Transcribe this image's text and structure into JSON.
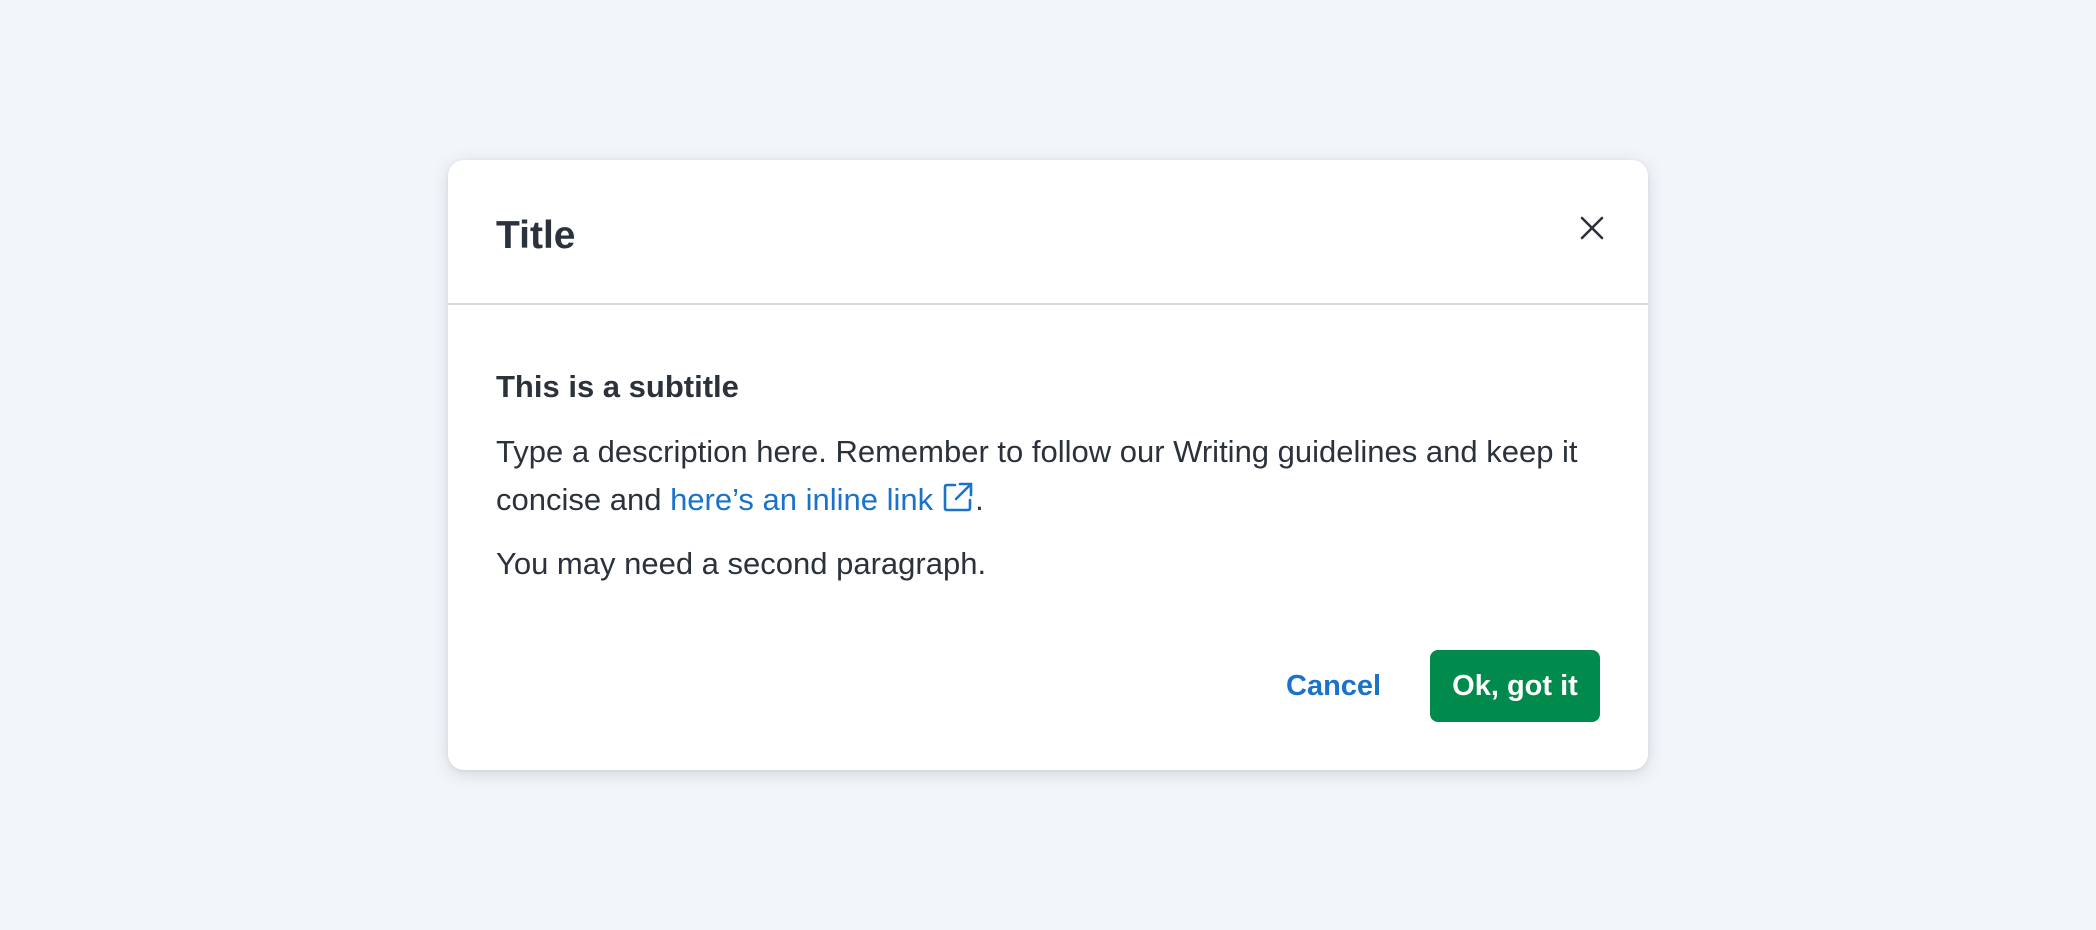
{
  "dialog": {
    "title": "Title",
    "close_icon": "close-icon",
    "subtitle": "This is a subtitle",
    "description_text": "Type a description here. Remember to follow our Writing guidelines and keep it concise and ",
    "link_text": "here’s an inline link",
    "link_icon": "external-link-icon",
    "description_end": ".",
    "second_paragraph": "You may need a second paragraph.",
    "cancel_label": "Cancel",
    "confirm_label": "Ok, got it"
  },
  "colors": {
    "background": "#f2f6fa",
    "text": "#2b323b",
    "link": "#1a73c9",
    "primary_button": "#008a4b",
    "divider": "#d5d9de"
  }
}
